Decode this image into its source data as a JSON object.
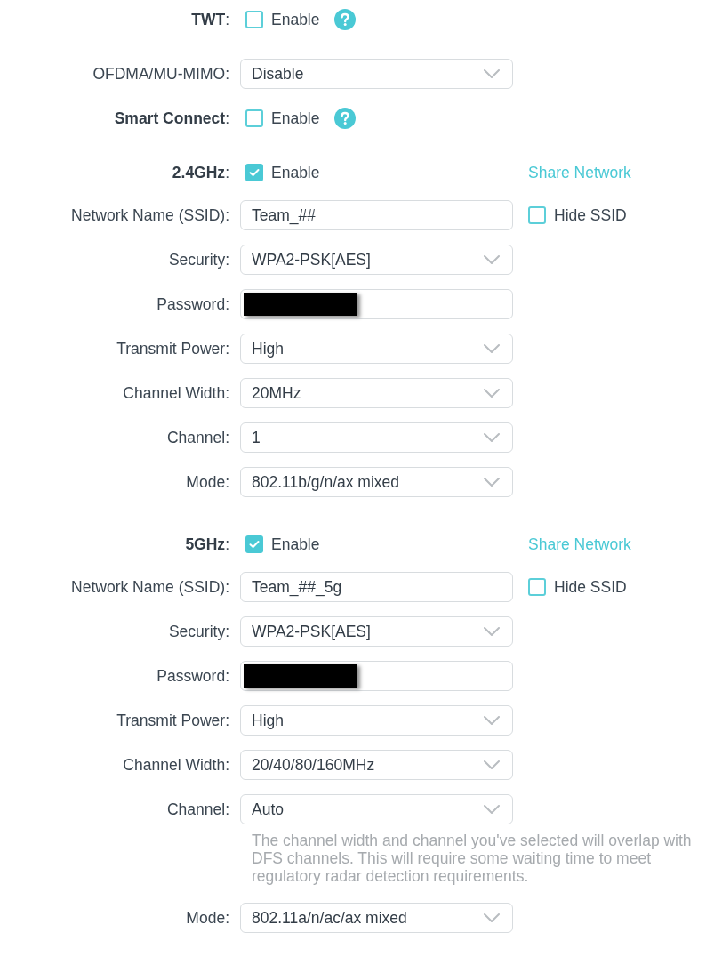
{
  "general": [
    {
      "kind": "checkbox",
      "label": "**TWT**:",
      "option": "Enable",
      "checked": false,
      "help": true
    },
    {
      "kind": "select",
      "label": "OFDMA/MU-MIMO:",
      "value": "Disable"
    },
    {
      "kind": "checkbox",
      "label": "**Smart Connect**:",
      "option": "Enable",
      "checked": false,
      "help": true
    }
  ],
  "bands": [
    {
      "label": "**2.4GHz**:",
      "option": "Enable",
      "enabled": true,
      "link": "Share Network",
      "fields": [
        {
          "kind": "text",
          "label": "Network Name (SSID):",
          "value": "Team_##",
          "side_option": {
            "label": "Hide SSID",
            "checked": false
          }
        },
        {
          "kind": "select",
          "label": "Security:",
          "value": "WPA2-PSK[AES]"
        },
        {
          "kind": "password",
          "label": "Password:",
          "redacted": true
        },
        {
          "kind": "select",
          "label": "Transmit Power:",
          "value": "High"
        },
        {
          "kind": "select",
          "label": "Channel Width:",
          "value": "20MHz"
        },
        {
          "kind": "select",
          "label": "Channel:",
          "value": "1"
        },
        {
          "kind": "select",
          "label": "Mode:",
          "value": "802.11b/g/n/ax mixed"
        }
      ]
    },
    {
      "label": "**5GHz**:",
      "option": "Enable",
      "enabled": true,
      "link": "Share Network",
      "fields": [
        {
          "kind": "text",
          "label": "Network Name (SSID):",
          "value": "Team_##_5g",
          "side_option": {
            "label": "Hide SSID",
            "checked": false
          }
        },
        {
          "kind": "select",
          "label": "Security:",
          "value": "WPA2-PSK[AES]"
        },
        {
          "kind": "password",
          "label": "Password:",
          "redacted": true
        },
        {
          "kind": "select",
          "label": "Transmit Power:",
          "value": "High"
        },
        {
          "kind": "select",
          "label": "Channel Width:",
          "value": "20/40/80/160MHz"
        },
        {
          "kind": "select",
          "label": "Channel:",
          "value": "Auto",
          "note": "The channel width and channel you've selected will overlap with DFS channels. This will require some waiting time to meet regulatory radar detection requirements."
        },
        {
          "kind": "select",
          "label": "Mode:",
          "value": "802.11a/n/ac/ax mixed"
        }
      ]
    }
  ]
}
